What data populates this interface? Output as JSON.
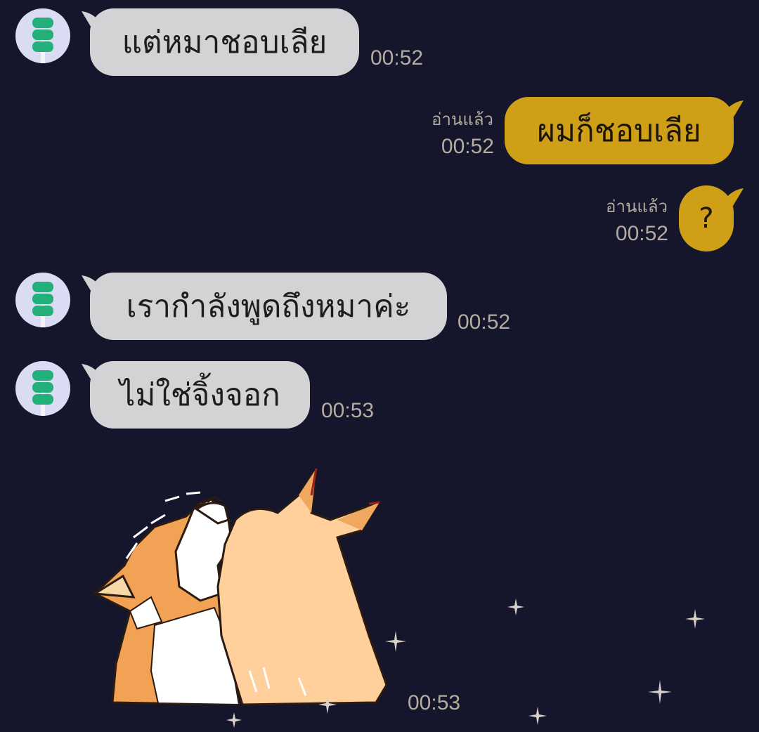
{
  "messages": [
    {
      "text": "แต่หมาชอบเลีย",
      "time": "00:52"
    },
    {
      "text": "ผมก็ชอบเลีย",
      "time": "00:52",
      "status": "อ่านแล้ว"
    },
    {
      "text": "?",
      "time": "00:52",
      "status": "อ่านแล้ว"
    },
    {
      "text": "เรากำลังพูดถึงหมาค่ะ",
      "time": "00:52"
    },
    {
      "text": "ไม่ใช่จิ้งจอก",
      "time": "00:53"
    },
    {
      "time": "00:53"
    }
  ],
  "colors": {
    "background": "#15162b",
    "incoming_bubble": "#d3d3d6",
    "outgoing_bubble": "#cf9f17",
    "meta_text": "#b4aca0",
    "avatar_bg": "#d9dcf2",
    "avatar_icon": "#23b07a"
  },
  "icons": {
    "avatar": "green-stacked-circles-icon"
  }
}
